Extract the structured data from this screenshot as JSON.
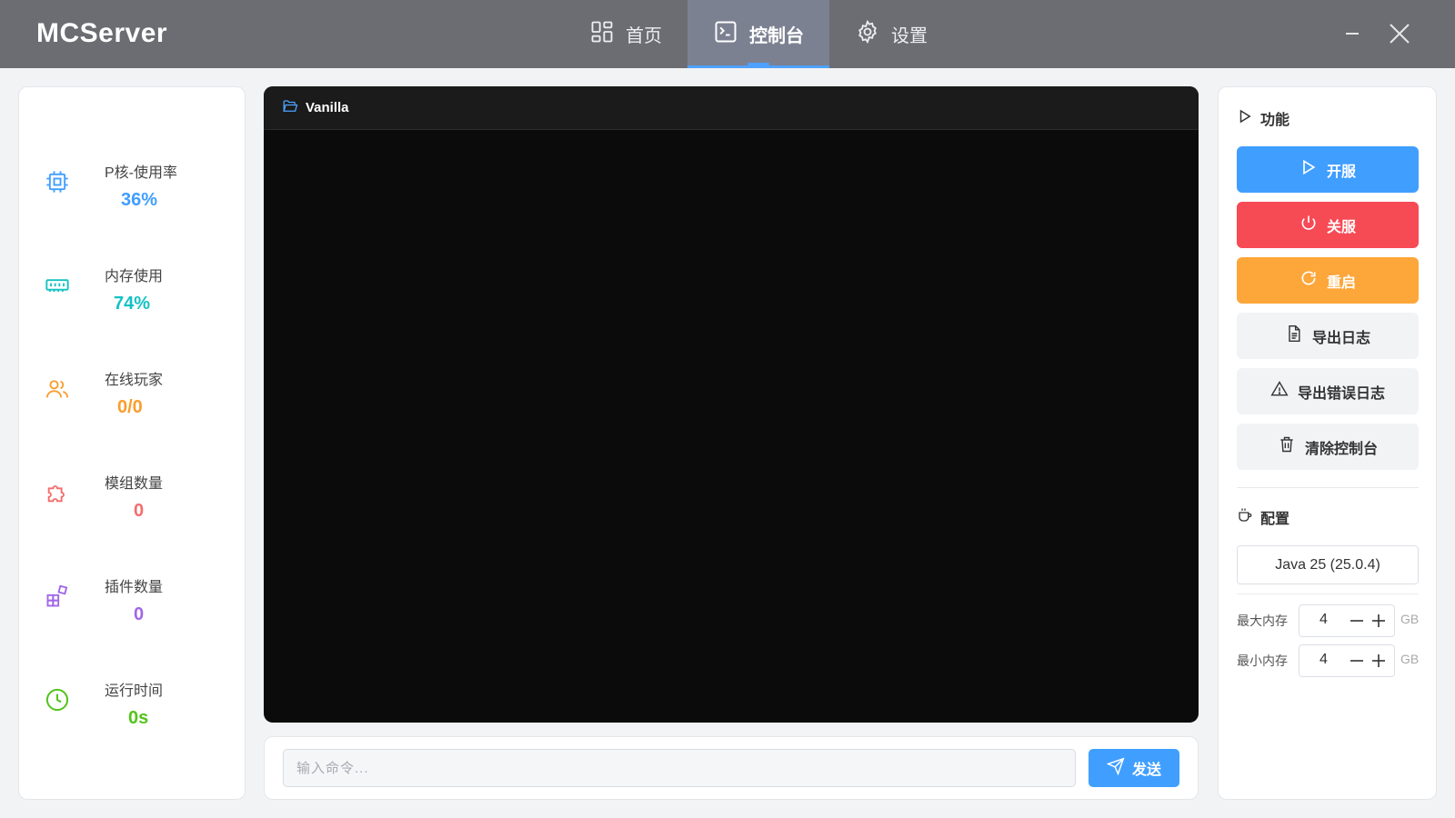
{
  "app": {
    "title": "MCServer"
  },
  "tabs": [
    {
      "label": "首页",
      "icon": "dashboard-icon",
      "active": false
    },
    {
      "label": "控制台",
      "icon": "terminal-icon",
      "active": true
    },
    {
      "label": "设置",
      "icon": "gear-icon",
      "active": false
    }
  ],
  "stats": [
    {
      "label": "P核-使用率",
      "value": "36%",
      "icon": "cpu-icon",
      "color": "#409eff"
    },
    {
      "label": "内存使用",
      "value": "74%",
      "icon": "memory-icon",
      "color": "#13c2c2"
    },
    {
      "label": "在线玩家",
      "value": "0/0",
      "icon": "users-icon",
      "color": "#fa9d2e"
    },
    {
      "label": "模组数量",
      "value": "0",
      "icon": "puzzle-icon",
      "color": "#f56c6c"
    },
    {
      "label": "插件数量",
      "value": "0",
      "icon": "apps-icon",
      "color": "#a066e8"
    },
    {
      "label": "运行时间",
      "value": "0s",
      "icon": "clock-icon",
      "color": "#52c41a"
    }
  ],
  "console": {
    "server_name": "Vanilla"
  },
  "command": {
    "placeholder": "输入命令...",
    "send_label": "发送"
  },
  "panel": {
    "functions_title": "功能",
    "buttons": {
      "start": "开服",
      "stop": "关服",
      "restart": "重启",
      "export_log": "导出日志",
      "export_error_log": "导出错误日志",
      "clear_console": "清除控制台"
    },
    "config_title": "配置",
    "java_version": "Java 25 (25.0.4)",
    "max_memory": {
      "label": "最大内存",
      "value": "4",
      "unit": "GB"
    },
    "min_memory": {
      "label": "最小内存",
      "value": "4",
      "unit": "GB"
    }
  },
  "colors": {
    "accent": "#409eff",
    "danger": "#f64a55",
    "warning": "#fda63a",
    "titlebar": "#6b6d73"
  }
}
